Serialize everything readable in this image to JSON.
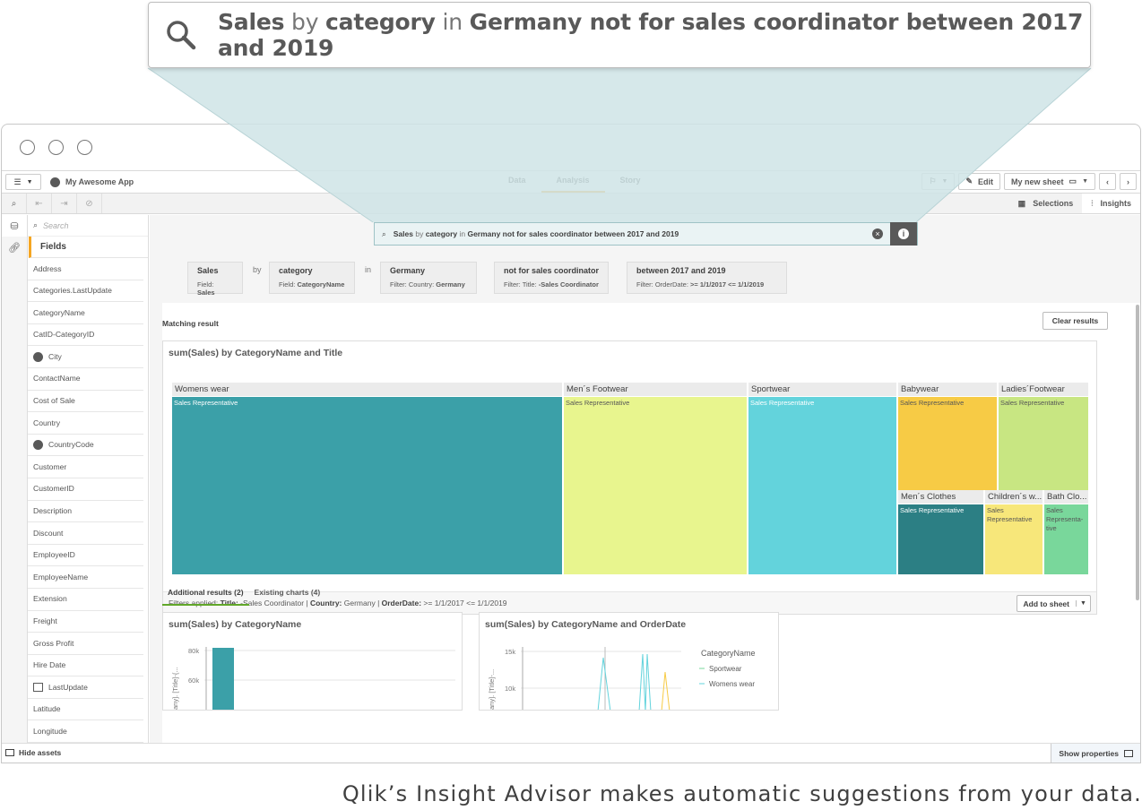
{
  "callout": {
    "query_parts": [
      {
        "text": "Sales",
        "style": "bold"
      },
      {
        "text": " by ",
        "style": "muted"
      },
      {
        "text": "category",
        "style": "bold"
      },
      {
        "text": " in ",
        "style": "muted"
      },
      {
        "text": "Germany not for sales coordinator between 2017 and 2019",
        "style": "bold"
      }
    ],
    "icon": "search-icon"
  },
  "topbar": {
    "app_title": "My Awesome App",
    "nav_tabs": [
      "Data",
      "Analysis",
      "Story"
    ],
    "active_tab": "Analysis",
    "edit_label": "Edit",
    "sheet_name": "My new sheet"
  },
  "toolrow": {
    "selections_label": "Selections",
    "insights_label": "Insights"
  },
  "assets": {
    "search_placeholder": "Search",
    "fields_heading": "Fields",
    "fields": [
      {
        "label": "Address",
        "icon": ""
      },
      {
        "label": "Categories.LastUpdate",
        "icon": ""
      },
      {
        "label": "CategoryName",
        "icon": ""
      },
      {
        "label": "CatID-CategoryID",
        "icon": ""
      },
      {
        "label": "City",
        "icon": "globe-icon"
      },
      {
        "label": "ContactName",
        "icon": ""
      },
      {
        "label": "Cost of Sale",
        "icon": ""
      },
      {
        "label": "Country",
        "icon": ""
      },
      {
        "label": "CountryCode",
        "icon": "globe-icon"
      },
      {
        "label": "Customer",
        "icon": ""
      },
      {
        "label": "CustomerID",
        "icon": ""
      },
      {
        "label": "Description",
        "icon": ""
      },
      {
        "label": "Discount",
        "icon": ""
      },
      {
        "label": "EmployeeID",
        "icon": ""
      },
      {
        "label": "EmployeeName",
        "icon": ""
      },
      {
        "label": "Extension",
        "icon": ""
      },
      {
        "label": "Freight",
        "icon": ""
      },
      {
        "label": "Gross Profit",
        "icon": ""
      },
      {
        "label": "Hire Date",
        "icon": ""
      },
      {
        "label": "LastUpdate",
        "icon": "calendar-icon"
      },
      {
        "label": "Latitude",
        "icon": ""
      },
      {
        "label": "Longitude",
        "icon": ""
      }
    ]
  },
  "query_bar": {
    "parts": [
      {
        "text": "Sales",
        "style": "bold"
      },
      {
        "text": " by ",
        "style": "muted"
      },
      {
        "text": "category",
        "style": "bold"
      },
      {
        "text": " in ",
        "style": "muted"
      },
      {
        "text": "Germany not for sales coordinator between 2017 and 2019",
        "style": "bold"
      }
    ]
  },
  "tokens": [
    {
      "title": "Sales",
      "sub_label": "Field:",
      "sub_value": "Sales"
    },
    {
      "title": "category",
      "sub_label": "Field:",
      "sub_value": "CategoryName"
    },
    {
      "title": "Germany",
      "sub_label": "Filter: Country:",
      "sub_value": "Germany"
    },
    {
      "title": "not for sales coordinator",
      "sub_label": "Filter: Title:",
      "sub_value": "-Sales Coordinator"
    },
    {
      "title": "between 2017 and 2019",
      "sub_label": "Filter: OrderDate:",
      "sub_value": ">= 1/1/2017 <= 1/1/2019"
    }
  ],
  "connectors": [
    "by",
    "in"
  ],
  "results": {
    "matching_label": "Matching result",
    "clear_label": "Clear results",
    "main_chart_title": "sum(Sales) by CategoryName and Title",
    "filters_applied": [
      {
        "text": "Filters applied: ",
        "bold": false
      },
      {
        "text": "Title:",
        "bold": true
      },
      {
        "text": " -Sales Coordinator | ",
        "bold": false
      },
      {
        "text": "Country:",
        "bold": true
      },
      {
        "text": " Germany | ",
        "bold": false
      },
      {
        "text": "OrderDate:",
        "bold": true
      },
      {
        "text": " >= 1/1/2017 <= 1/1/2019",
        "bold": false
      }
    ],
    "add_to_sheet_label": "Add to sheet",
    "tabs": [
      "Additional results (2)",
      "Existing charts (4)"
    ],
    "card1_title": "sum(Sales) by CategoryName",
    "card1_ylabel": "any]. [Title]-{...",
    "card1_ticks": [
      "80k",
      "60k"
    ],
    "card2_title": "sum(Sales) by CategoryName and OrderDate",
    "card2_ylabel": "any]. [Title]-...",
    "card2_ticks": [
      "15k",
      "10k"
    ],
    "card2_legend_title": "CategoryName",
    "card2_legend": [
      "Sportwear",
      "Womens wear"
    ]
  },
  "chart_data": {
    "type": "treemap",
    "title": "sum(Sales) by CategoryName and Title",
    "nodes": [
      {
        "category": "Womens wear",
        "title": "Sales Representative",
        "color": "#3ba0a8"
      },
      {
        "category": "Men´s Footwear",
        "title": "Sales Representative",
        "color": "#e8f58e"
      },
      {
        "category": "Sportwear",
        "title": "Sales Representative",
        "color": "#63d3dc"
      },
      {
        "category": "Babywear",
        "title": "Sales Representative",
        "color": "#f7cb45"
      },
      {
        "category": "Ladies´Footwear",
        "title": "Sales Representative",
        "color": "#c8e682"
      },
      {
        "category": "Men´s Clothes",
        "title": "Sales Representative",
        "color": "#2c7f84"
      },
      {
        "category": "Children´s w...",
        "title": "Sales Representative",
        "color": "#f7e77a"
      },
      {
        "category": "Bath Clo...",
        "title": "Sales Representa-tive",
        "color": "#79d79b"
      }
    ]
  },
  "bottombar": {
    "hide_assets_label": "Hide assets",
    "show_properties_label": "Show properties"
  },
  "caption": "Qlik’s Insight Advisor makes automatic suggestions from your data."
}
